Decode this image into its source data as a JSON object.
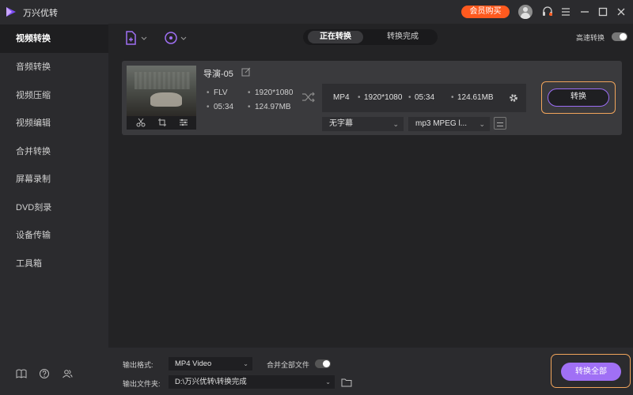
{
  "app": {
    "title": "万兴优转",
    "vip_label": "会员购买"
  },
  "sidebar": {
    "items": [
      {
        "label": "视频转换"
      },
      {
        "label": "音频转换"
      },
      {
        "label": "视频压缩"
      },
      {
        "label": "视频编辑"
      },
      {
        "label": "合并转换"
      },
      {
        "label": "屏幕录制"
      },
      {
        "label": "DVD刻录"
      },
      {
        "label": "设备传输"
      },
      {
        "label": "工具箱"
      }
    ]
  },
  "toolbar": {
    "tabs": [
      {
        "label": "正在转换"
      },
      {
        "label": "转换完成"
      }
    ],
    "high_speed_label": "高速转换",
    "high_speed_on": true
  },
  "file": {
    "name": "导演-05",
    "source": {
      "format": "FLV",
      "resolution": "1920*1080",
      "duration": "05:34",
      "size": "124.97MB"
    },
    "output": {
      "format": "MP4",
      "resolution": "1920*1080",
      "duration": "05:34",
      "size": "124.61MB"
    },
    "subtitle": "无字幕",
    "audio": "mp3 MPEG l...",
    "convert_label": "转换"
  },
  "bottom": {
    "format_label": "输出格式:",
    "format_value": "MP4 Video",
    "merge_label": "合并全部文件",
    "merge_on": false,
    "folder_label": "输出文件夹:",
    "folder_value": "D:\\万兴优转\\转换完成",
    "convert_all_label": "转换全部"
  },
  "colors": {
    "accent": "#a070f5",
    "highlight": "#f0a45b",
    "vip": "#ff5a1f"
  }
}
